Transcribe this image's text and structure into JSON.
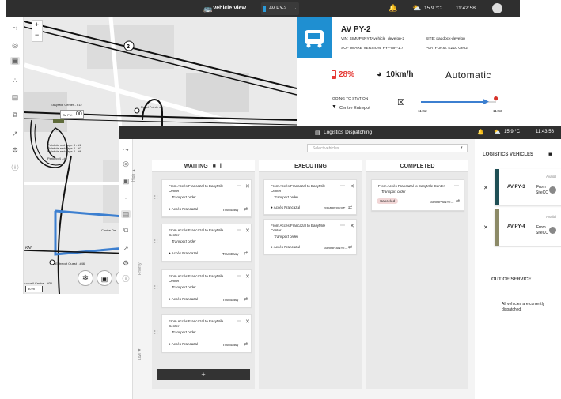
{
  "bg": {
    "topbar": {
      "view_label": "Vehicle View",
      "vehicle_select": "AV PY-2",
      "temperature": "15.9 °C",
      "time": "11:42:58"
    },
    "zoom": {
      "in": "+",
      "out": "−"
    },
    "map_labels": {
      "road_num": "2",
      "road_point": "Road Point - #1",
      "easymile_center": "EasyMile Center - #12",
      "av_marker_pre": "AV PY-",
      "av_marker_num": "00",
      "point_a": "Point de recharge 3 - #8",
      "point_b": "Point de recharge 4 - #7",
      "point_c": "Point de recharge 2 - #6",
      "parking": "Parking 4 - #9",
      "centre_de": "Centre De",
      "entrepot_ouest": "Entrepot Ouest - #46",
      "accueil_centre": "Accueil Centre - #31",
      "km": "KM",
      "scale": "30 m"
    },
    "vehicle": {
      "name": "AV PY-2",
      "vin_line": "VIN: SIMUPSNYTAvehicle_develop-2",
      "site_line": "SITE: paddock-develop",
      "software_line": "SOFTWARE VERSION: PY-FMP-1.7",
      "platform_line": "PLATFORM: EZ10 Gen2",
      "battery": "28%",
      "speed": "10km/h",
      "mode": "Automatic",
      "going_to_label": "GOING TO STATION",
      "going_to_station": "Centre Entrepot",
      "time_start": "11:42",
      "time_end": "11:43",
      "route_progress": 0.82
    }
  },
  "fg": {
    "topbar": {
      "title": "Logistics Dispatching",
      "temperature": "15.9 °C",
      "time": "11:43:56"
    },
    "select_placeholder": "Select vehicles...",
    "priority": {
      "high": "High ▲",
      "priority": "Priority",
      "low": "Low ▼"
    },
    "columns": {
      "waiting": "WAITING",
      "executing": "EXECUTING",
      "completed": "COMPLETED"
    },
    "waiting_cards": [
      {
        "title": "From Accès Francazal to EasyMile Center",
        "sub": "Transport order",
        "loc": "Accès Francazal",
        "vehicle": "TramEasy"
      },
      {
        "title": "From Accès Francazal to EasyMile Center",
        "sub": "Transport order",
        "loc": "Accès Francazal",
        "vehicle": "TramEasy"
      },
      {
        "title": "From Accès Francazal to EasyMile Center",
        "sub": "Transport order",
        "loc": "Accès Francazal",
        "vehicle": "TramEasy"
      },
      {
        "title": "From Accès Francazal to EasyMile Center",
        "sub": "Transport order",
        "loc": "Accès Francazal",
        "vehicle": "TramEasy"
      }
    ],
    "executing_cards": [
      {
        "title": "From Accès Francazal to EasyMile Center",
        "sub": "Transport order",
        "loc": "Accès Francazal",
        "vehicle": "SIMUPSNYT..."
      },
      {
        "title": "From Accès Francazal to EasyMile Center",
        "sub": "Transport order",
        "loc": "Accès Francazal",
        "vehicle": "SIMUPSNYT..."
      }
    ],
    "completed_cards": [
      {
        "title": "From Accès Francazal to EasyMile Center",
        "sub": "Transport order",
        "status": "Canceled",
        "vehicle": "SIMUPSNYT..."
      }
    ],
    "add_button": "+",
    "vehicles_panel": {
      "title": "LOGISTICS VEHICLES",
      "vehicles": [
        {
          "name": "AV PY-3",
          "from": "From",
          "station": "SiteCC",
          "status": "Availal"
        },
        {
          "name": "AV PY-4",
          "from": "From",
          "station": "SiteCC",
          "status": "Availal"
        }
      ],
      "out_of_service_title": "OUT OF SERVICE",
      "out_of_service_msg": "All vehicles are currently dispatched."
    },
    "colors": {
      "dark_bar": "#2f2f2f",
      "vehicle_header": "#1f8fd1",
      "route_blue": "#3c7fd0",
      "battery_red": "#e53935",
      "pin_red": "#d7332b",
      "vehicle3_color": "#1f4f55",
      "vehicle4_color": "#8c8a67",
      "canceled_badge": "#f1d6d6"
    }
  }
}
